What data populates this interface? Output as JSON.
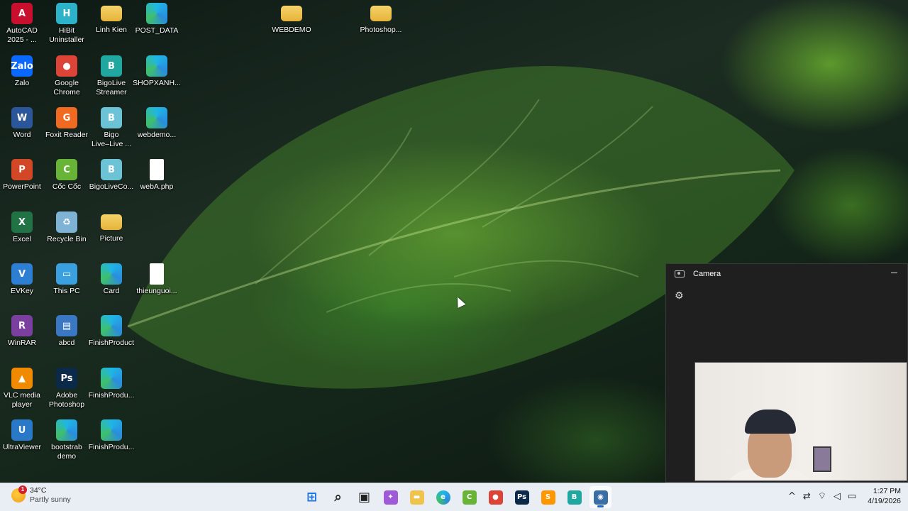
{
  "desktop": {
    "icons": [
      {
        "label": "AutoCAD\n2025 - ...",
        "icon": "autocad-icon",
        "color": "#c8102e",
        "glyph": "A"
      },
      {
        "label": "HiBit\nUninstaller",
        "icon": "hibit-uninstaller-icon",
        "color": "#2cb3c9",
        "glyph": "H"
      },
      {
        "label": "Linh Kien",
        "icon": "folder-icon",
        "color": "#f0c44c",
        "glyph": ""
      },
      {
        "label": "POST_DATA",
        "icon": "edge-icon",
        "color": "#1fb6e6",
        "glyph": ""
      },
      {
        "label": "WEBDEMO",
        "icon": "folder-icon",
        "color": "#f0c44c",
        "glyph": ""
      },
      {
        "label": "Photoshop...",
        "icon": "folder-icon",
        "color": "#f0c44c",
        "glyph": ""
      },
      {
        "label": "Zalo",
        "icon": "zalo-icon",
        "color": "#0a68ff",
        "glyph": "Zalo"
      },
      {
        "label": "Google\nChrome",
        "icon": "chrome-icon",
        "color": "#db4437",
        "glyph": "●"
      },
      {
        "label": "BigoLive\nStreamer",
        "icon": "bigolive-streamer-icon",
        "color": "#1fa7a0",
        "glyph": "B"
      },
      {
        "label": "SHOPXANH...",
        "icon": "edge-icon",
        "color": "#1fb6e6",
        "glyph": ""
      },
      {
        "label": "Word",
        "icon": "word-icon",
        "color": "#2b579a",
        "glyph": "W"
      },
      {
        "label": "Foxit Reader",
        "icon": "foxit-reader-icon",
        "color": "#f06a21",
        "glyph": "G"
      },
      {
        "label": "Bigo\nLive–Live ...",
        "icon": "bigo-live-icon",
        "color": "#6cc3d5",
        "glyph": "B"
      },
      {
        "label": "webdemo...",
        "icon": "edge-icon",
        "color": "#1fb6e6",
        "glyph": ""
      },
      {
        "label": "PowerPoint",
        "icon": "powerpoint-icon",
        "color": "#d24726",
        "glyph": "P"
      },
      {
        "label": "Cốc Cốc",
        "icon": "coccoc-icon",
        "color": "#67b437",
        "glyph": "C"
      },
      {
        "label": "BigoLiveCo...",
        "icon": "bigolive-connector-icon",
        "color": "#6cc3d5",
        "glyph": "B"
      },
      {
        "label": "webA.php",
        "icon": "file-icon",
        "color": "#ffffff",
        "glyph": ""
      },
      {
        "label": "Excel",
        "icon": "excel-icon",
        "color": "#217346",
        "glyph": "X"
      },
      {
        "label": "Recycle Bin",
        "icon": "recycle-bin-icon",
        "color": "#7fb3d5",
        "glyph": "♻"
      },
      {
        "label": "Picture",
        "icon": "folder-icon",
        "color": "#f0c44c",
        "glyph": ""
      },
      {
        "label": "EVKey",
        "icon": "evkey-icon",
        "color": "#2d7fd3",
        "glyph": "V"
      },
      {
        "label": "This PC",
        "icon": "this-pc-icon",
        "color": "#3aa0e0",
        "glyph": "▭"
      },
      {
        "label": "Card",
        "icon": "edge-icon",
        "color": "#1fb6e6",
        "glyph": ""
      },
      {
        "label": "thieunguoi...",
        "icon": "file-icon",
        "color": "#ffffff",
        "glyph": ""
      },
      {
        "label": "WinRAR",
        "icon": "winrar-icon",
        "color": "#7b3fa0",
        "glyph": "R"
      },
      {
        "label": "abcd",
        "icon": "document-icon",
        "color": "#3a78c4",
        "glyph": "▤"
      },
      {
        "label": "FinishProduct",
        "icon": "edge-icon",
        "color": "#1fb6e6",
        "glyph": ""
      },
      {
        "label": "VLC media\nplayer",
        "icon": "vlc-icon",
        "color": "#f08a00",
        "glyph": "▲"
      },
      {
        "label": "Adobe\nPhotoshop",
        "icon": "photoshop-icon",
        "color": "#0b2a4a",
        "glyph": "Ps"
      },
      {
        "label": "FinishProdu...",
        "icon": "edge-icon",
        "color": "#1fb6e6",
        "glyph": ""
      },
      {
        "label": "UltraViewer",
        "icon": "ultraviewer-icon",
        "color": "#2a78c8",
        "glyph": "U"
      },
      {
        "label": "bootstrab\ndemo",
        "icon": "edge-icon",
        "color": "#1fb6e6",
        "glyph": ""
      },
      {
        "label": "FinishProdu...",
        "icon": "edge-icon",
        "color": "#1fb6e6",
        "glyph": ""
      }
    ]
  },
  "camera_window": {
    "title": "Camera",
    "settings_icon": "gear-icon",
    "minimize_icon": "minimize-icon"
  },
  "taskbar": {
    "weather": {
      "temperature": "34°C",
      "condition": "Partly sunny",
      "badge": "1"
    },
    "apps": [
      {
        "name": "start",
        "icon": "windows-start-icon",
        "color": "#1b73e8",
        "glyph": "⊞"
      },
      {
        "name": "search",
        "icon": "search-icon",
        "color": "#222222",
        "glyph": "⌕"
      },
      {
        "name": "task-view",
        "icon": "task-view-icon",
        "color": "#222222",
        "glyph": "▣"
      },
      {
        "name": "copilot",
        "icon": "copilot-icon",
        "color": "#a05ad9",
        "glyph": "✦"
      },
      {
        "name": "file-explorer",
        "icon": "folder-icon",
        "color": "#f0c44c",
        "glyph": "▬"
      },
      {
        "name": "edge",
        "icon": "edge-icon",
        "color": "#1fb6e6",
        "glyph": "e"
      },
      {
        "name": "coccoc",
        "icon": "coccoc-icon",
        "color": "#67b437",
        "glyph": "C"
      },
      {
        "name": "chrome",
        "icon": "chrome-icon",
        "color": "#db4437",
        "glyph": "●"
      },
      {
        "name": "photoshop",
        "icon": "photoshop-icon",
        "color": "#0b2a4a",
        "glyph": "Ps"
      },
      {
        "name": "sublime-text",
        "icon": "sublime-text-icon",
        "color": "#ff9800",
        "glyph": "S"
      },
      {
        "name": "bigolive",
        "icon": "bigolive-icon",
        "color": "#1fa7a0",
        "glyph": "B"
      },
      {
        "name": "camera",
        "icon": "camera-icon",
        "color": "#3a6ea5",
        "glyph": "◉"
      }
    ],
    "tray": {
      "chevron": "^",
      "time": "1:27 PM",
      "date": "4/19/2026"
    }
  }
}
